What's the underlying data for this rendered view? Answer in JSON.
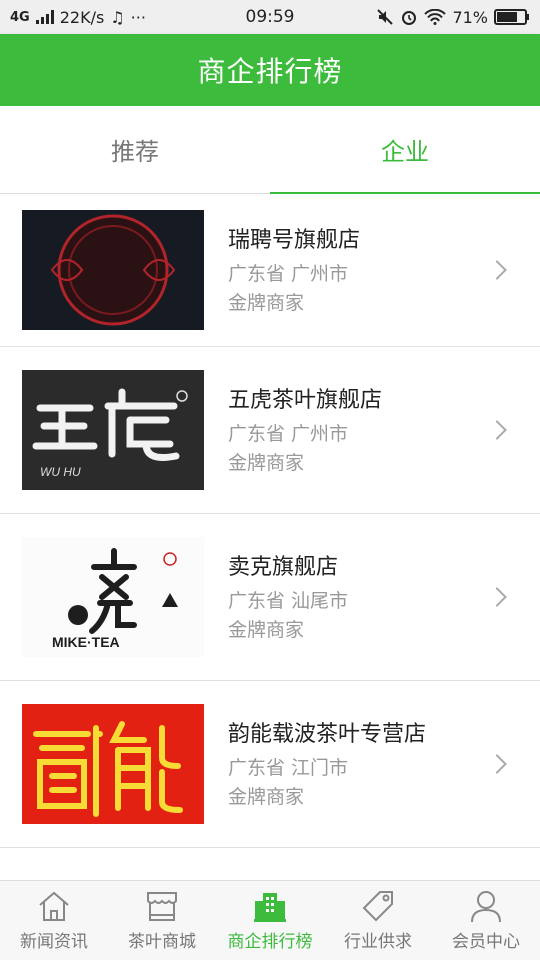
{
  "status": {
    "network": "4G",
    "speed": "22K/s",
    "dots": "···",
    "time": "09:59",
    "battery": "71%"
  },
  "header": {
    "title": "商企排行榜"
  },
  "tabs": [
    {
      "label": "推荐",
      "active": false
    },
    {
      "label": "企业",
      "active": true
    }
  ],
  "shops": [
    {
      "name": "瑞聘号旗舰店",
      "location": "广东省 广州市",
      "level": "金牌商家",
      "logo_text": "瑞聘號"
    },
    {
      "name": "五虎茶叶旗舰店",
      "location": "广东省 广州市",
      "level": "金牌商家",
      "logo_text": "五虎",
      "logo_sub": "WU HU"
    },
    {
      "name": "卖克旗舰店",
      "location": "广东省 汕尾市",
      "level": "金牌商家",
      "logo_text": "卖克",
      "logo_sub": "MIKE TEA",
      "logo_badge": "茶"
    },
    {
      "name": "韵能载波茶叶专营店",
      "location": "广东省 江门市",
      "level": "金牌商家",
      "logo_text": "韵能"
    }
  ],
  "tabbar": [
    {
      "label": "新闻资讯",
      "icon": "home-icon",
      "active": false
    },
    {
      "label": "茶叶商城",
      "icon": "shop-icon",
      "active": false
    },
    {
      "label": "商企排行榜",
      "icon": "building-icon",
      "active": true
    },
    {
      "label": "行业供求",
      "icon": "tag-icon",
      "active": false
    },
    {
      "label": "会员中心",
      "icon": "user-icon",
      "active": false
    }
  ],
  "colors": {
    "accent": "#3dbb3d"
  }
}
